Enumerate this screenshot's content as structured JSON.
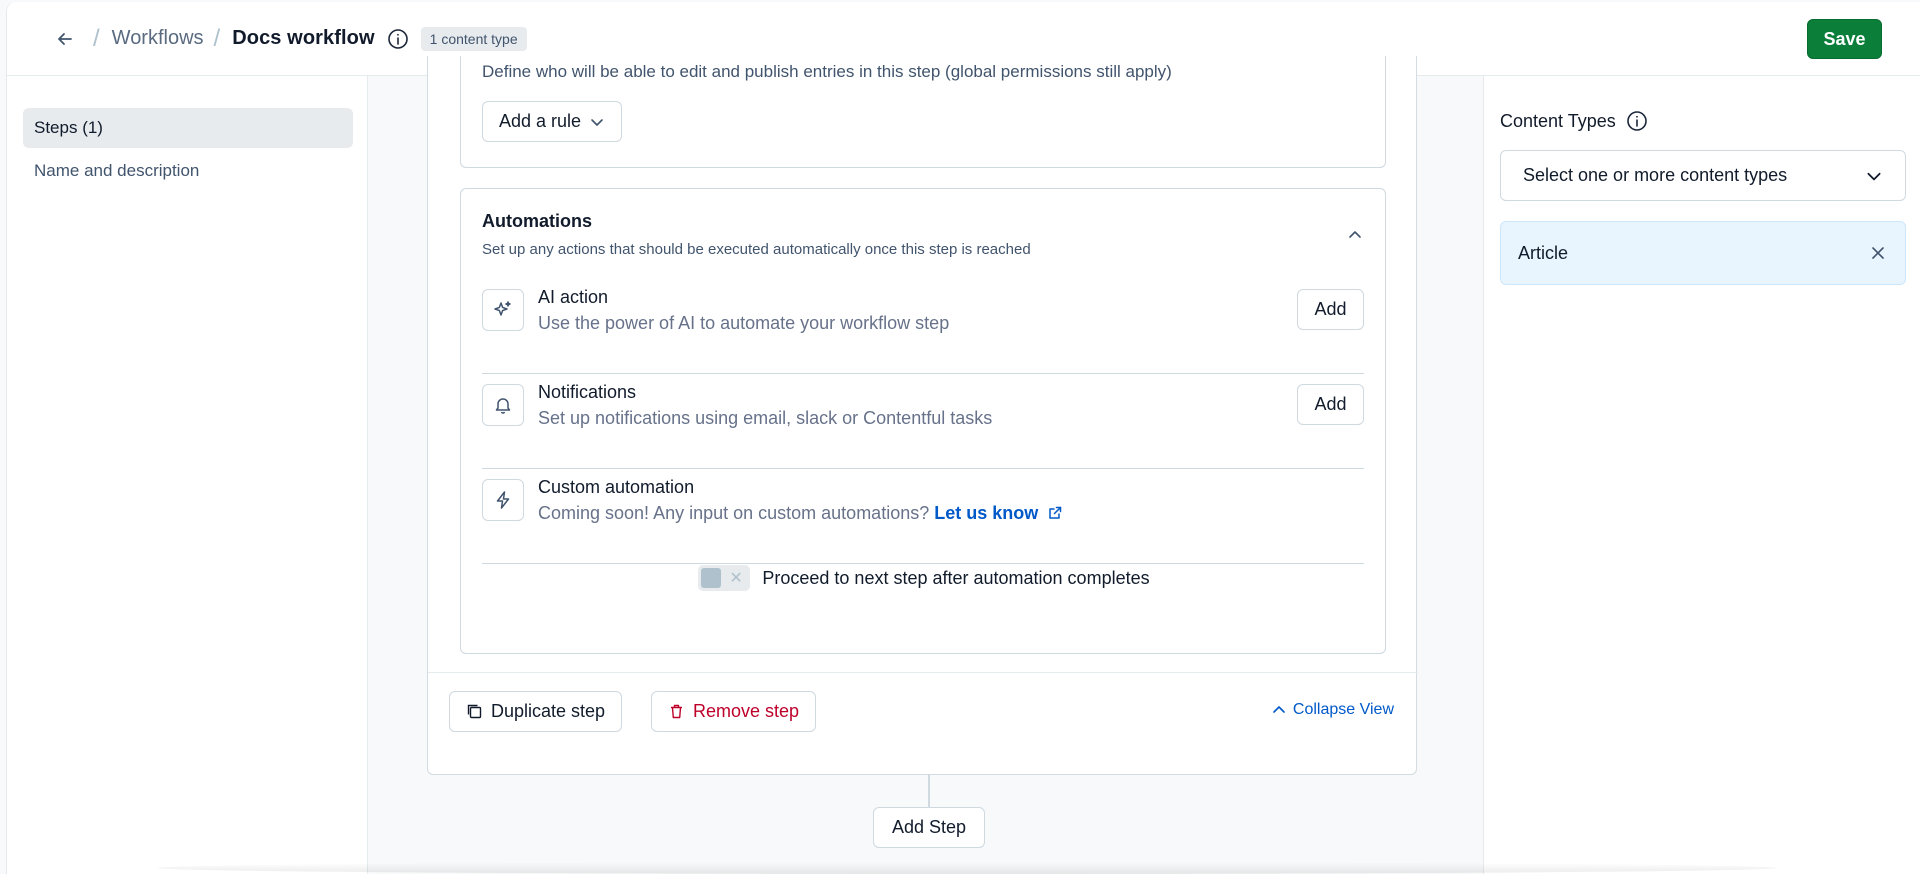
{
  "header": {
    "breadcrumb_link": "Workflows",
    "title": "Docs workflow",
    "badge": "1 content type",
    "save_label": "Save"
  },
  "sidebar": {
    "items": [
      {
        "label": "Steps (1)",
        "active": true
      },
      {
        "label": "Name and description",
        "active": false
      }
    ]
  },
  "step": {
    "rules_description": "Define who will be able to edit and publish entries in this step (global permissions still apply)",
    "add_rule_label": "Add a rule",
    "automations": {
      "title": "Automations",
      "subtitle": "Set up any actions that should be executed automatically once this step is reached",
      "rows": [
        {
          "title": "AI action",
          "description": "Use the power of AI to automate your workflow step",
          "button": "Add",
          "icon": "sparkle-icon"
        },
        {
          "title": "Notifications",
          "description": "Set up notifications using email, slack or Contentful tasks",
          "button": "Add",
          "icon": "bell-icon"
        },
        {
          "title": "Custom automation",
          "description": "Coming soon! Any input on custom automations?",
          "link": "Let us know",
          "icon": "lightning-icon"
        }
      ],
      "toggle_label": "Proceed to next step after automation completes",
      "toggle_on": false
    },
    "duplicate_label": "Duplicate step",
    "remove_label": "Remove step",
    "collapse_label": "Collapse View"
  },
  "add_step_label": "Add Step",
  "right": {
    "content_types_label": "Content Types",
    "select_placeholder": "Select one or more content types",
    "selected": [
      "Article"
    ]
  },
  "colors": {
    "save": "#0b7f3a",
    "link": "#0059c8",
    "danger": "#bd002a",
    "selected_bg": "#e8f5ff"
  }
}
